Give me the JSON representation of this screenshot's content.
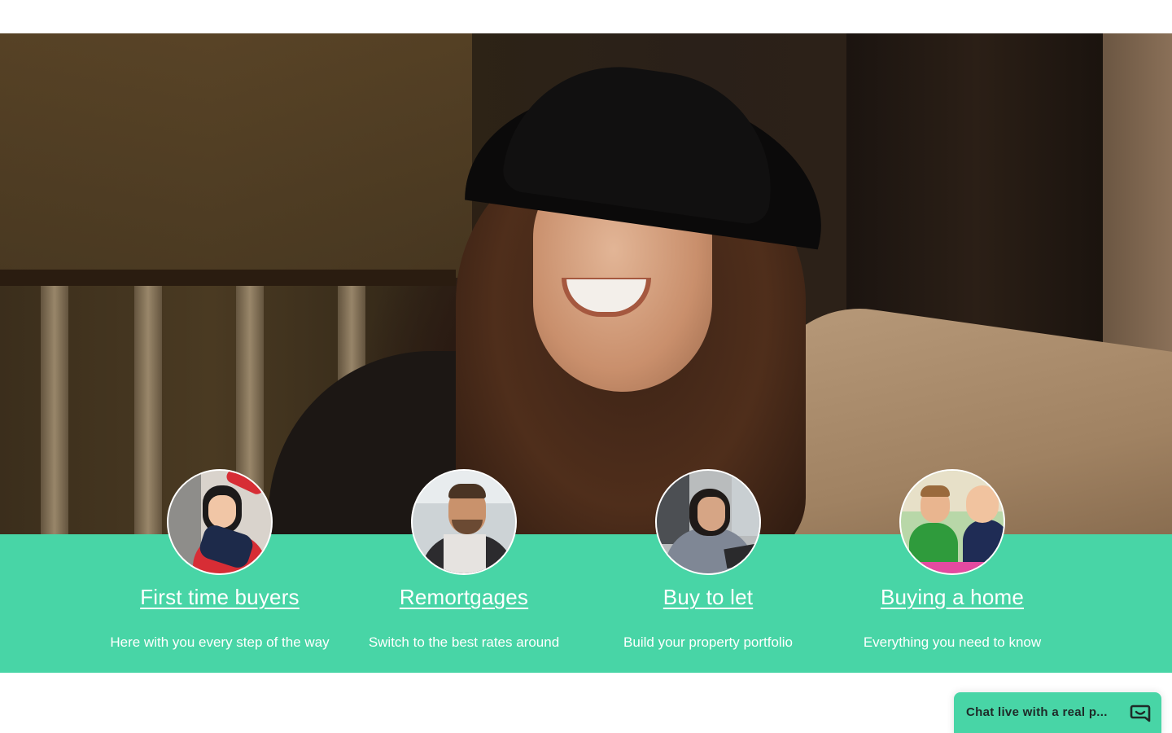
{
  "hero": {
    "image_alt": "Smiling woman wearing a black hat"
  },
  "services": [
    {
      "title": "First time buyers",
      "subtitle": "Here with you every step of the way",
      "image": "woman-with-pillow-avatar"
    },
    {
      "title": "Remortgages",
      "subtitle": "Switch to the best rates around",
      "image": "laughing-man-avatar"
    },
    {
      "title": "Buy to let",
      "subtitle": "Build your property portfolio",
      "image": "woman-at-laptop-avatar"
    },
    {
      "title": "Buying a home",
      "subtitle": "Everything you need to know",
      "image": "children-playing-avatar"
    }
  ],
  "chat": {
    "label": "Chat live with a real p...",
    "icon": "chat-bubble-icon"
  },
  "colors": {
    "accent": "#48d5a6",
    "text_light": "#ffffff",
    "chat_text": "#1e2a28"
  }
}
